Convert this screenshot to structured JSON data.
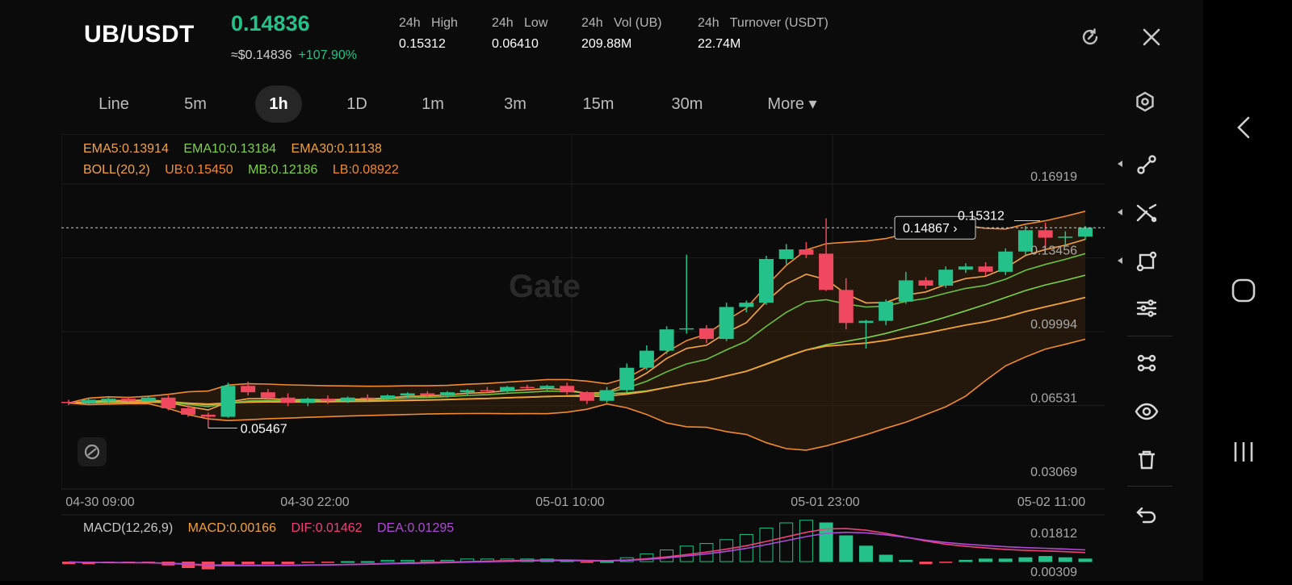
{
  "header": {
    "pair": "UB/USDT",
    "price": "0.14836",
    "price_usd": "≈$0.14836",
    "change": "+107.90%",
    "stats": [
      {
        "label": "24h   High",
        "value": "0.15312"
      },
      {
        "label": "24h   Low",
        "value": "0.06410"
      },
      {
        "label": "24h   Vol (UB)",
        "value": "209.88M"
      },
      {
        "label": "24h   Turnover (USDT)",
        "value": "22.74M"
      }
    ]
  },
  "tabs": [
    {
      "label": "Line",
      "active": false
    },
    {
      "label": "5m",
      "active": false
    },
    {
      "label": "1h",
      "active": true
    },
    {
      "label": "1D",
      "active": false
    },
    {
      "label": "1m",
      "active": false
    },
    {
      "label": "3m",
      "active": false
    },
    {
      "label": "15m",
      "active": false
    },
    {
      "label": "30m",
      "active": false
    },
    {
      "label": "More ▾",
      "active": false
    }
  ],
  "indicators": {
    "ema5": "EMA5:0.13914",
    "ema10": "EMA10:0.13184",
    "ema30": "EMA30:0.11138",
    "boll": "BOLL(20,2)",
    "ub": "UB:0.15450",
    "mb": "MB:0.12186",
    "lb": "LB:0.08922",
    "macd": "MACD(12,26,9)",
    "macd_val": "MACD:0.00166",
    "dif": "DIF:0.01462",
    "dea": "DEA:0.01295"
  },
  "colors": {
    "up": "#24c28a",
    "down": "#f0485f",
    "ema5": "#f5a34b",
    "ema10": "#7fd24a",
    "ema30": "#f3a23a",
    "boll_band": "#f28a32",
    "dif": "#f0407a",
    "dea": "#b04ad8"
  },
  "chart_data": {
    "type": "candlestick",
    "watermark": "Gate",
    "y_ticks": [
      "0.16919",
      "0.13456",
      "0.09994",
      "0.06531",
      "0.03069"
    ],
    "x_ticks": [
      "04-30 09:00",
      "04-30 22:00",
      "05-01 10:00",
      "05-01 23:00",
      "05-02 11:00"
    ],
    "ylim": [
      0.03069,
      0.16919
    ],
    "current_price_label": "0.14867",
    "high_label": "0.15312",
    "low_label": "0.05467",
    "macd_ticks": [
      "0.01812",
      "0.00309"
    ],
    "candles": [
      {
        "o": 0.067,
        "h": 0.068,
        "l": 0.0655,
        "c": 0.0665
      },
      {
        "o": 0.0665,
        "h": 0.0685,
        "l": 0.066,
        "c": 0.068
      },
      {
        "o": 0.0675,
        "h": 0.069,
        "l": 0.0665,
        "c": 0.0685
      },
      {
        "o": 0.0685,
        "h": 0.0695,
        "l": 0.067,
        "c": 0.0675
      },
      {
        "o": 0.0675,
        "h": 0.07,
        "l": 0.067,
        "c": 0.069
      },
      {
        "o": 0.069,
        "h": 0.07,
        "l": 0.063,
        "c": 0.064
      },
      {
        "o": 0.064,
        "h": 0.066,
        "l": 0.06,
        "c": 0.061
      },
      {
        "o": 0.061,
        "h": 0.062,
        "l": 0.0547,
        "c": 0.06
      },
      {
        "o": 0.06,
        "h": 0.076,
        "l": 0.0595,
        "c": 0.0745
      },
      {
        "o": 0.0745,
        "h": 0.0765,
        "l": 0.07,
        "c": 0.0715
      },
      {
        "o": 0.0715,
        "h": 0.073,
        "l": 0.068,
        "c": 0.069
      },
      {
        "o": 0.069,
        "h": 0.071,
        "l": 0.065,
        "c": 0.0665
      },
      {
        "o": 0.0665,
        "h": 0.069,
        "l": 0.065,
        "c": 0.0685
      },
      {
        "o": 0.0685,
        "h": 0.07,
        "l": 0.066,
        "c": 0.0675
      },
      {
        "o": 0.0675,
        "h": 0.0695,
        "l": 0.0665,
        "c": 0.069
      },
      {
        "o": 0.069,
        "h": 0.0705,
        "l": 0.0675,
        "c": 0.0685
      },
      {
        "o": 0.0685,
        "h": 0.0705,
        "l": 0.068,
        "c": 0.07
      },
      {
        "o": 0.07,
        "h": 0.0715,
        "l": 0.0685,
        "c": 0.071
      },
      {
        "o": 0.071,
        "h": 0.072,
        "l": 0.069,
        "c": 0.07
      },
      {
        "o": 0.07,
        "h": 0.072,
        "l": 0.069,
        "c": 0.0715
      },
      {
        "o": 0.0715,
        "h": 0.073,
        "l": 0.07,
        "c": 0.0725
      },
      {
        "o": 0.0725,
        "h": 0.074,
        "l": 0.071,
        "c": 0.072
      },
      {
        "o": 0.072,
        "h": 0.0745,
        "l": 0.0715,
        "c": 0.074
      },
      {
        "o": 0.074,
        "h": 0.075,
        "l": 0.0725,
        "c": 0.0735
      },
      {
        "o": 0.0735,
        "h": 0.075,
        "l": 0.072,
        "c": 0.0745
      },
      {
        "o": 0.0745,
        "h": 0.076,
        "l": 0.0705,
        "c": 0.0715
      },
      {
        "o": 0.0715,
        "h": 0.072,
        "l": 0.066,
        "c": 0.0675
      },
      {
        "o": 0.0675,
        "h": 0.074,
        "l": 0.0665,
        "c": 0.0725
      },
      {
        "o": 0.0725,
        "h": 0.085,
        "l": 0.0715,
        "c": 0.083
      },
      {
        "o": 0.083,
        "h": 0.0935,
        "l": 0.082,
        "c": 0.091
      },
      {
        "o": 0.091,
        "h": 0.1025,
        "l": 0.0895,
        "c": 0.101
      },
      {
        "o": 0.101,
        "h": 0.136,
        "l": 0.099,
        "c": 0.1015
      },
      {
        "o": 0.1015,
        "h": 0.103,
        "l": 0.0945,
        "c": 0.0965
      },
      {
        "o": 0.0965,
        "h": 0.1135,
        "l": 0.0955,
        "c": 0.1115
      },
      {
        "o": 0.1115,
        "h": 0.1145,
        "l": 0.109,
        "c": 0.1135
      },
      {
        "o": 0.1135,
        "h": 0.1355,
        "l": 0.1125,
        "c": 0.134
      },
      {
        "o": 0.134,
        "h": 0.141,
        "l": 0.1315,
        "c": 0.1385
      },
      {
        "o": 0.1385,
        "h": 0.142,
        "l": 0.1345,
        "c": 0.136
      },
      {
        "o": 0.1365,
        "h": 0.1531,
        "l": 0.119,
        "c": 0.1195
      },
      {
        "o": 0.1195,
        "h": 0.125,
        "l": 0.101,
        "c": 0.104
      },
      {
        "o": 0.104,
        "h": 0.1055,
        "l": 0.092,
        "c": 0.105
      },
      {
        "o": 0.105,
        "h": 0.115,
        "l": 0.103,
        "c": 0.114
      },
      {
        "o": 0.114,
        "h": 0.128,
        "l": 0.113,
        "c": 0.124
      },
      {
        "o": 0.124,
        "h": 0.1255,
        "l": 0.12,
        "c": 0.1215
      },
      {
        "o": 0.1215,
        "h": 0.1305,
        "l": 0.1205,
        "c": 0.129
      },
      {
        "o": 0.129,
        "h": 0.132,
        "l": 0.1275,
        "c": 0.1305
      },
      {
        "o": 0.1305,
        "h": 0.1325,
        "l": 0.126,
        "c": 0.128
      },
      {
        "o": 0.128,
        "h": 0.139,
        "l": 0.1265,
        "c": 0.1375
      },
      {
        "o": 0.1375,
        "h": 0.1495,
        "l": 0.136,
        "c": 0.1475
      },
      {
        "o": 0.1475,
        "h": 0.151,
        "l": 0.138,
        "c": 0.144
      },
      {
        "o": 0.144,
        "h": 0.147,
        "l": 0.14,
        "c": 0.1445
      },
      {
        "o": 0.1445,
        "h": 0.1495,
        "l": 0.143,
        "c": 0.1487
      }
    ],
    "macd_hist": [
      -0.0002,
      -0.0002,
      -0.0001,
      -0.0001,
      -0.0001,
      -0.0003,
      -0.0005,
      -0.0006,
      -0.0003,
      -0.0002,
      -0.0002,
      -0.0002,
      -0.0001,
      -0.0001,
      0.0,
      0.0,
      0.0001,
      0.0001,
      0.0001,
      0.0001,
      0.0002,
      0.0002,
      0.0002,
      0.0002,
      0.0002,
      0.0001,
      -0.0001,
      0.0,
      0.0003,
      0.0006,
      0.0009,
      0.0012,
      0.0014,
      0.0017,
      0.0021,
      0.0026,
      0.003,
      0.0032,
      0.003,
      0.002,
      0.0012,
      0.0005,
      0.0001,
      -0.0002,
      -0.0001,
      0.0001,
      0.0002,
      0.0002,
      0.0003,
      0.0004,
      0.0003,
      0.0002
    ]
  },
  "icons": {
    "header": [
      "refresh-icon",
      "close-icon"
    ],
    "sidebar": [
      "node-line-icon",
      "cross-line-icon",
      "rect-shape-icon",
      "sliders-icon",
      "chain-icon",
      "eye-icon",
      "trash-icon",
      "undo-icon"
    ],
    "nav": [
      "back-icon",
      "home-icon",
      "recents-icon"
    ]
  }
}
